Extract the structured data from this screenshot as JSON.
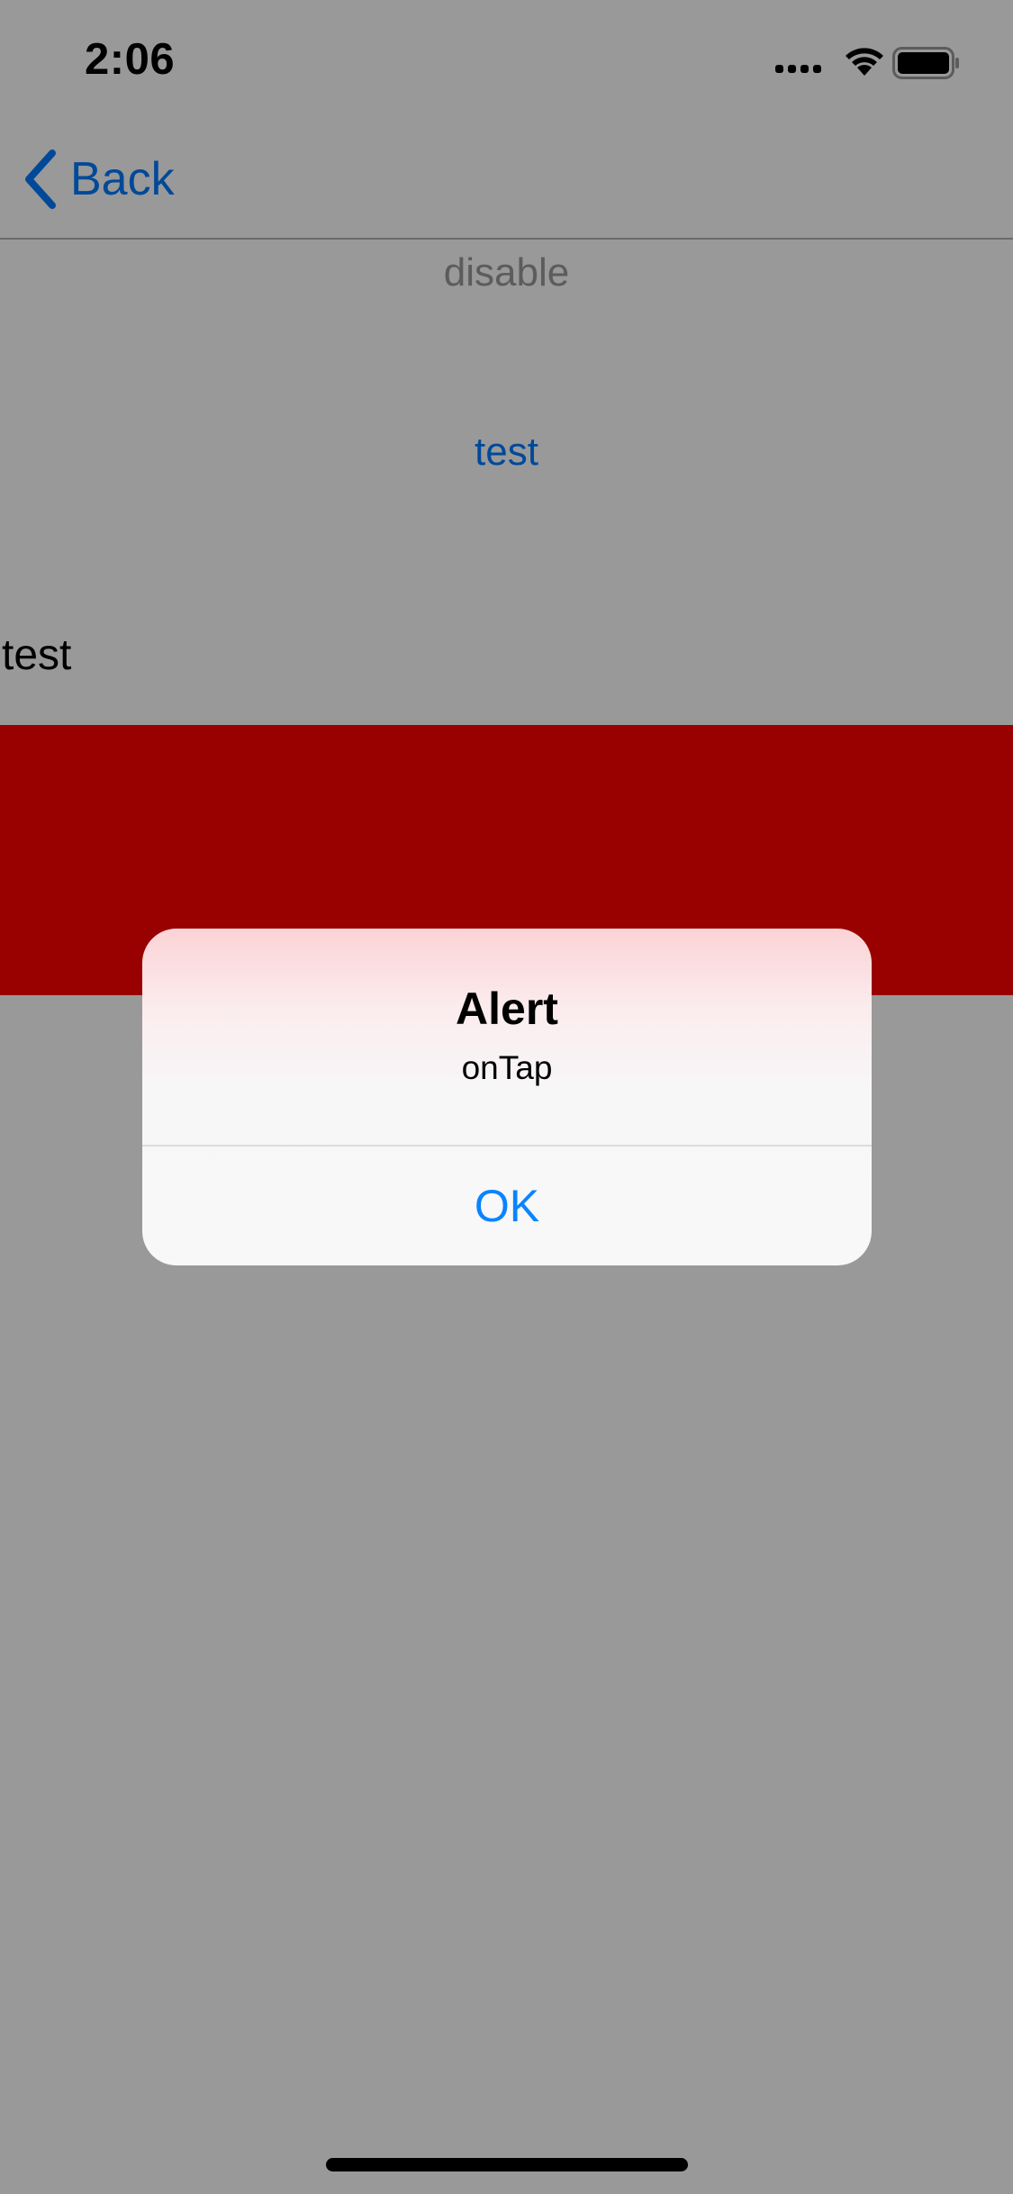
{
  "status_bar": {
    "time": "2:06",
    "icons": [
      "cellular-signal-icon",
      "wifi-icon",
      "battery-icon"
    ]
  },
  "nav": {
    "back_label": "Back",
    "back_icon": "chevron-left-icon"
  },
  "content": {
    "disable_label": "disable",
    "test_button_label": "test",
    "test_text": "test",
    "red_block_color": "#ff0000"
  },
  "alert": {
    "title": "Alert",
    "message": "onTap",
    "ok_label": "OK"
  },
  "colors": {
    "accent": "#007aff",
    "overlay": "rgba(0,0,0,0.4)",
    "disabled_text": "#9a9a9a"
  }
}
